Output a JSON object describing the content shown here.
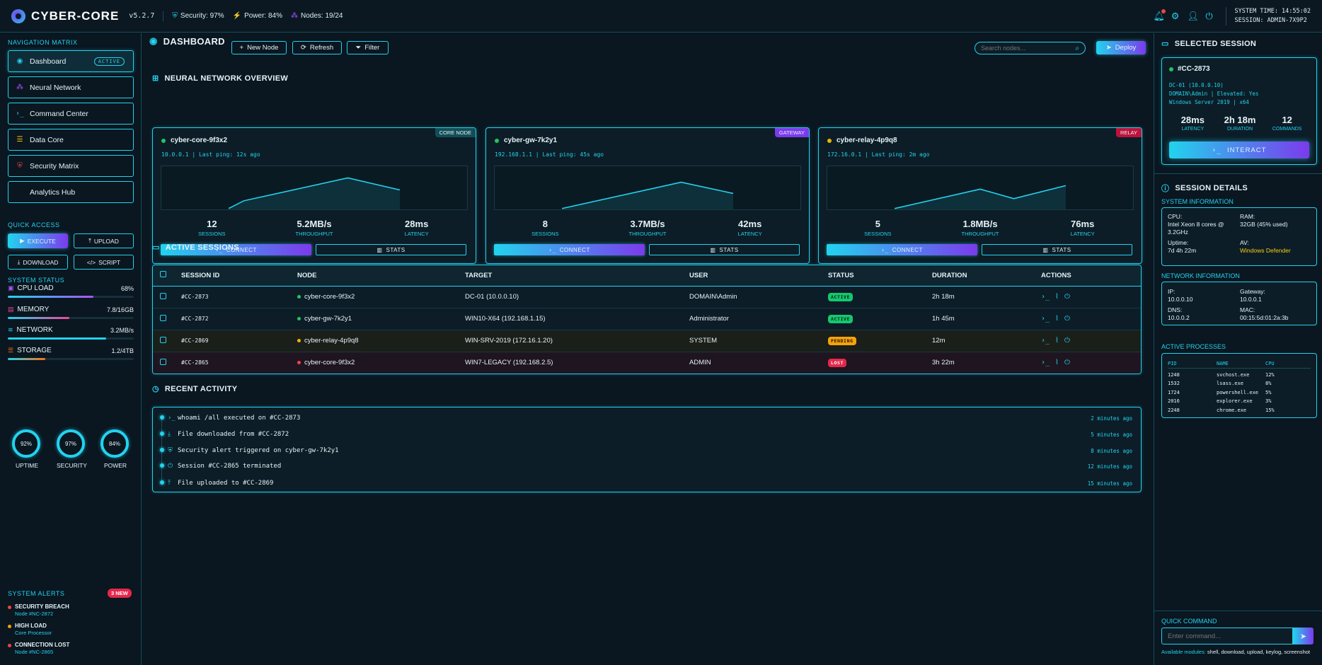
{
  "app": {
    "title": "CYBER-CORE",
    "version": "v5.2.7",
    "security": "Security: 97%",
    "power": "Power: 84%",
    "nodes": "Nodes: 19/24",
    "system_time": "SYSTEM TIME: 14:55:02",
    "session": "SESSION: ADMIN-7X9P2"
  },
  "sidebar": {
    "nav_label": "NAVIGATION MATRIX",
    "nav": [
      {
        "label": "Dashboard",
        "icon": "gauge-icon",
        "active": true,
        "badge": "ACTIVE"
      },
      {
        "label": "Neural Network",
        "icon": "network-icon"
      },
      {
        "label": "Command Center",
        "icon": "terminal-icon"
      },
      {
        "label": "Data Core",
        "icon": "database-icon"
      },
      {
        "label": "Security Matrix",
        "icon": "shield-icon"
      },
      {
        "label": "Analytics Hub",
        "icon": "chart-icon"
      }
    ],
    "quick_label": "QUICK ACCESS",
    "quick": [
      "EXECUTE",
      "UPLOAD",
      "DOWNLOAD",
      "SCRIPT"
    ],
    "status_label": "SYSTEM STATUS",
    "status": [
      {
        "label": "CPU LOAD",
        "value": "68%",
        "level": 0.68,
        "color": "#a855f7"
      },
      {
        "label": "MEMORY",
        "value": "7.8/16GB",
        "level": 0.49,
        "color": "#ec4899"
      },
      {
        "label": "NETWORK",
        "value": "3.2MB/s",
        "level": 0.78,
        "color": "#22d3ee"
      },
      {
        "label": "STORAGE",
        "value": "1.2/4TB",
        "level": 0.3,
        "color": "#f97316"
      }
    ],
    "gauges": [
      {
        "label": "UPTIME",
        "value": "92%"
      },
      {
        "label": "SECURITY",
        "value": "97%"
      },
      {
        "label": "POWER",
        "value": "84%"
      }
    ],
    "alerts_label": "SYSTEM ALERTS",
    "alerts_badge": "3 NEW",
    "alerts": [
      {
        "title": "SECURITY BREACH",
        "sub": "Node #NC-2872",
        "color": "#ef4444"
      },
      {
        "title": "HIGH LOAD",
        "sub": "Core Processor",
        "color": "#f59e0b"
      },
      {
        "title": "CONNECTION LOST",
        "sub": "Node #NC-2865",
        "color": "#ef4444"
      }
    ]
  },
  "header": {
    "title": "DASHBOARD",
    "new_node": "New Node",
    "refresh": "Refresh",
    "filter": "Filter",
    "search_placeholder": "Search nodes...",
    "deploy": "Deploy"
  },
  "overview": {
    "title": "NEURAL NETWORK OVERVIEW",
    "nodes": [
      {
        "name": "cyber-core-9f3x2",
        "tag": "CORE NODE",
        "tag_color": "#134e57",
        "dot": "#22c55e",
        "ip": "10.0.0.1 | Last ping: 12s ago",
        "sessions": "12",
        "throughput": "5.2MB/s",
        "latency": "28ms"
      },
      {
        "name": "cyber-gw-7k2y1",
        "tag": "GATEWAY",
        "tag_color": "#7c3aed",
        "dot": "#22c55e",
        "ip": "192.168.1.1 | Last ping: 45s ago",
        "sessions": "8",
        "throughput": "3.7MB/s",
        "latency": "42ms"
      },
      {
        "name": "cyber-relay-4p9q8",
        "tag": "RELAY",
        "tag_color": "#be123c",
        "dot": "#eab308",
        "ip": "172.16.0.1 | Last ping: 2m ago",
        "sessions": "5",
        "throughput": "1.8MB/s",
        "latency": "76ms"
      }
    ],
    "labels": {
      "sessions": "SESSIONS",
      "throughput": "THROUGHPUT",
      "latency": "LATENCY",
      "connect": "CONNECT",
      "stats": "STATS"
    }
  },
  "sessions": {
    "title": "ACTIVE SESSIONS",
    "columns": [
      "SESSION ID",
      "NODE",
      "TARGET",
      "USER",
      "STATUS",
      "DURATION",
      "ACTIONS"
    ],
    "rows": [
      {
        "id": "#CC-2873",
        "node": "cyber-core-9f3x2",
        "dot": "#22c55e",
        "target": "DC-01 (10.0.0.10)",
        "user": "DOMAIN\\Admin",
        "status": "ACTIVE",
        "cls": "st-active",
        "duration": "2h 18m",
        "bg": "#0c1d27"
      },
      {
        "id": "#CC-2872",
        "node": "cyber-gw-7k2y1",
        "dot": "#22c55e",
        "target": "WIN10-X64 (192.168.1.15)",
        "user": "Administrator",
        "status": "ACTIVE",
        "cls": "st-active",
        "duration": "1h 45m",
        "bg": "#0c1d27"
      },
      {
        "id": "#CC-2869",
        "node": "cyber-relay-4p9q8",
        "dot": "#eab308",
        "target": "WIN-SRV-2019 (172.16.1.20)",
        "user": "SYSTEM",
        "status": "PENDING",
        "cls": "st-pending",
        "duration": "12m",
        "bg": "#1b1f1a"
      },
      {
        "id": "#CC-2865",
        "node": "cyber-core-9f3x2",
        "dot": "#ef4444",
        "target": "WIN7-LEGACY (192.168.2.5)",
        "user": "ADMIN",
        "status": "LOST",
        "cls": "st-lost",
        "duration": "3h 22m",
        "bg": "#1f1520"
      }
    ]
  },
  "activity": {
    "title": "RECENT ACTIVITY",
    "items": [
      {
        "icon": "terminal-icon",
        "glyph": "›_",
        "text": "whoami /all executed on #CC-2873",
        "time": "2 minutes ago"
      },
      {
        "icon": "download-icon",
        "glyph": "⤓",
        "text": "File downloaded from #CC-2872",
        "time": "5 minutes ago"
      },
      {
        "icon": "shield-icon",
        "glyph": "⛨",
        "text": "Security alert triggered on cyber-gw-7k2y1",
        "time": "8 minutes ago"
      },
      {
        "icon": "power-icon",
        "glyph": "⏻",
        "text": "Session #CC-2865 terminated",
        "time": "12 minutes ago"
      },
      {
        "icon": "upload-icon",
        "glyph": "⤒",
        "text": "File uploaded to #CC-2869",
        "time": "15 minutes ago"
      }
    ]
  },
  "selected": {
    "title": "SELECTED SESSION",
    "id": "#CC-2873",
    "line1": "DC-01 (10.0.0.10)",
    "line2": "DOMAIN\\Admin | Elevated: Yes",
    "line3": "Windows Server 2019 | x64",
    "latency": "28ms",
    "latency_lbl": "LATENCY",
    "duration": "2h 18m",
    "duration_lbl": "DURATION",
    "commands": "12",
    "commands_lbl": "COMMANDS",
    "interact": "INTERACT"
  },
  "details": {
    "title": "SESSION DETAILS",
    "sysinfo_label": "SYSTEM INFORMATION",
    "cpu_k": "CPU:",
    "cpu_v": "Intel Xeon 8 cores @ 3.2GHz",
    "ram_k": "RAM:",
    "ram_v": "32GB (45% used)",
    "uptime_k": "Uptime:",
    "uptime_v": "7d 4h 22m",
    "av_k": "AV:",
    "av_v": "Windows Defender",
    "netinfo_label": "NETWORK INFORMATION",
    "ip_k": "IP:",
    "ip_v": "10.0.0.10",
    "gw_k": "Gateway:",
    "gw_v": "10.0.0.1",
    "dns_k": "DNS:",
    "dns_v": "10.0.0.2",
    "mac_k": "MAC:",
    "mac_v": "00:15:5d:01:2a:3b",
    "proc_label": "ACTIVE PROCESSES",
    "proc_cols": [
      "PID",
      "NAME",
      "CPU"
    ],
    "procs": [
      [
        "1248",
        "svchost.exe",
        "12%"
      ],
      [
        "1532",
        "lsass.exe",
        "8%"
      ],
      [
        "1724",
        "powershell.exe",
        "5%"
      ],
      [
        "2016",
        "explorer.exe",
        "3%"
      ],
      [
        "2248",
        "chrome.exe",
        "15%"
      ]
    ],
    "quick_label": "QUICK COMMAND",
    "cmd_placeholder": "Enter command...",
    "modules_label": "Available modules:",
    "modules": "shell, download, upload, keylog, screenshot"
  }
}
